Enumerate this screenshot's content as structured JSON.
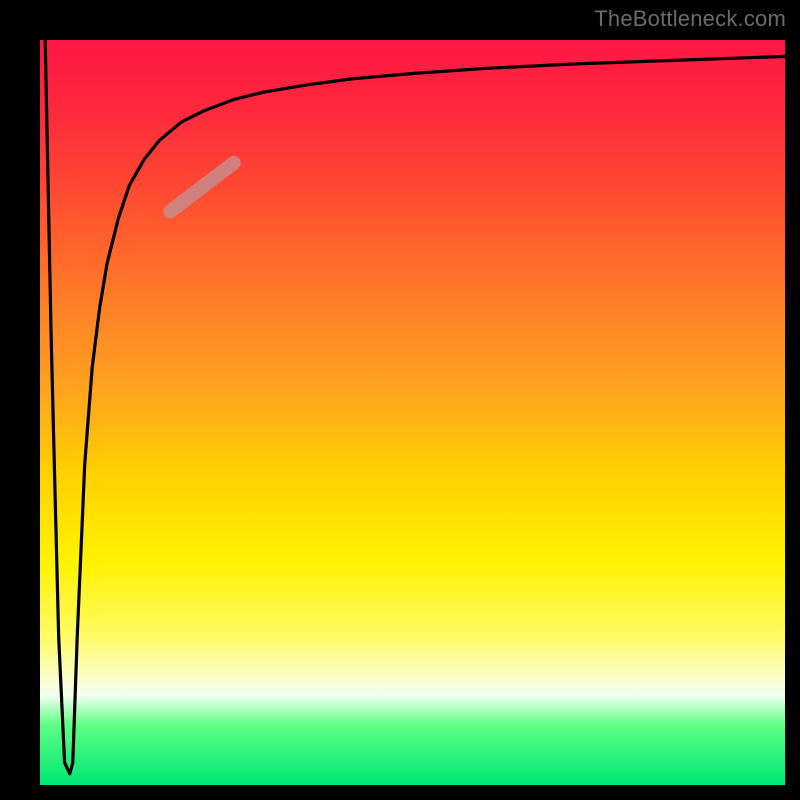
{
  "watermark": "TheBottleneck.com",
  "chart_data": {
    "type": "line",
    "title": "",
    "xlabel": "",
    "ylabel": "",
    "xlim": [
      0,
      100
    ],
    "ylim": [
      0,
      100
    ],
    "grid": false,
    "legend": false,
    "annotations": [],
    "series": [
      {
        "name": "curve",
        "color": "#000000",
        "x": [
          0.7,
          1.5,
          2.5,
          3.3,
          4.0,
          4.4,
          5.0,
          6.0,
          7.0,
          8.0,
          9.0,
          10.5,
          12.0,
          14.0,
          16.0,
          19.0,
          22.0,
          26.0,
          30.0,
          36.0,
          42.0,
          50.0,
          60.0,
          72.0,
          86.0,
          100.0
        ],
        "y": [
          100.0,
          60.0,
          20.0,
          3.0,
          1.5,
          3.0,
          20.0,
          43.0,
          56.0,
          64.0,
          70.0,
          76.0,
          80.5,
          84.0,
          86.5,
          89.0,
          90.5,
          92.0,
          93.0,
          94.0,
          94.8,
          95.5,
          96.2,
          96.8,
          97.3,
          97.8
        ]
      },
      {
        "name": "highlight-segment",
        "color": "#c98b8b",
        "x": [
          17.5,
          26.0
        ],
        "y": [
          77.0,
          83.5
        ]
      }
    ]
  }
}
